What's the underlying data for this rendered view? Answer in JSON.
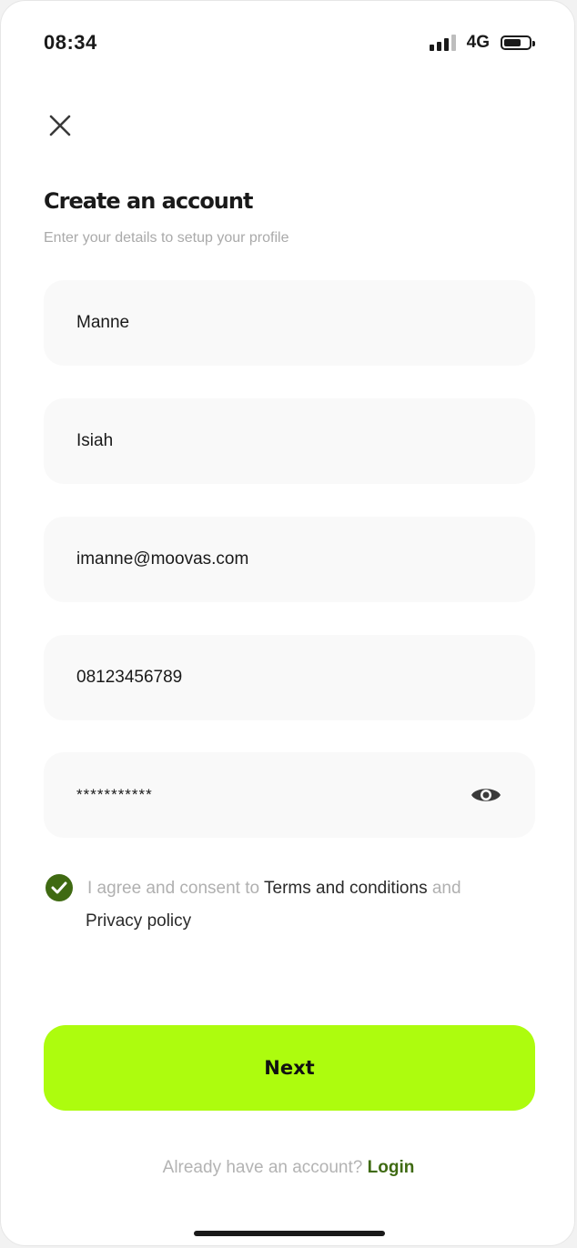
{
  "status_bar": {
    "time": "08:34",
    "network": "4G",
    "battery_level": 0.7
  },
  "header": {
    "close_icon": "close-icon",
    "title": "Create an account",
    "subtitle": "Enter your details to setup your profile"
  },
  "form": {
    "first_name": "Manne",
    "last_name": "Isiah",
    "email": "imanne@moovas.com",
    "phone": "08123456789",
    "password_masked": "***********",
    "password_toggle_icon": "eye-icon"
  },
  "agreement": {
    "checked": true,
    "prefix": "I agree and consent to ",
    "terms_label": "Terms and conditions",
    "conjunction": " and",
    "privacy_label": "Privacy policy"
  },
  "actions": {
    "next_label": "Next"
  },
  "footer": {
    "prompt": "Already have an account? ",
    "login_label": "Login"
  },
  "colors": {
    "accent": "#adfc0e",
    "brand_green": "#3f6a12"
  }
}
